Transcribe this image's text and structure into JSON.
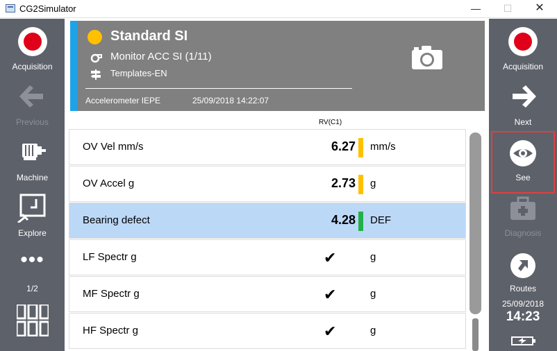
{
  "window": {
    "title": "CG2Simulator",
    "minimize_glyph": "—",
    "maximize_glyph": "☐",
    "close_glyph": "✕"
  },
  "left_sidebar": {
    "acquisition_label": "Acquisition",
    "previous_label": "Previous",
    "machine_label": "Machine",
    "explore_label": "Explore",
    "more_glyph": "•••",
    "page_indicator": "1/2"
  },
  "right_sidebar": {
    "acquisition_label": "Acquisition",
    "next_label": "Next",
    "see_label": "See",
    "diagnosis_label": "Diagnosis",
    "routes_label": "Routes",
    "date": "25/09/2018",
    "time": "14:23"
  },
  "header": {
    "title": "Standard SI",
    "monitor": "Monitor ACC SI (1/11)",
    "templates": "Templates-EN",
    "sensor": "Accelerometer IEPE",
    "datetime": "25/09/2018 14:22:07",
    "status_color": "#ffc000",
    "accent_color": "#1fa3e8"
  },
  "table": {
    "column_header": "RV(C1)",
    "rows": [
      {
        "name": "OV Vel mm/s",
        "value": "6.27",
        "unit": "mm/s",
        "status_color": "#ffc000"
      },
      {
        "name": "OV Accel g",
        "value": "2.73",
        "unit": "g",
        "status_color": "#ffc000"
      },
      {
        "name": "Bearing defect",
        "value": "4.28",
        "unit": "DEF",
        "status_color": "#22b04a"
      },
      {
        "name": "LF Spectr g",
        "check": "✔",
        "unit": "g"
      },
      {
        "name": "MF Spectr g",
        "check": "✔",
        "unit": "g"
      },
      {
        "name": "HF Spectr g",
        "check": "✔",
        "unit": "g"
      }
    ]
  }
}
